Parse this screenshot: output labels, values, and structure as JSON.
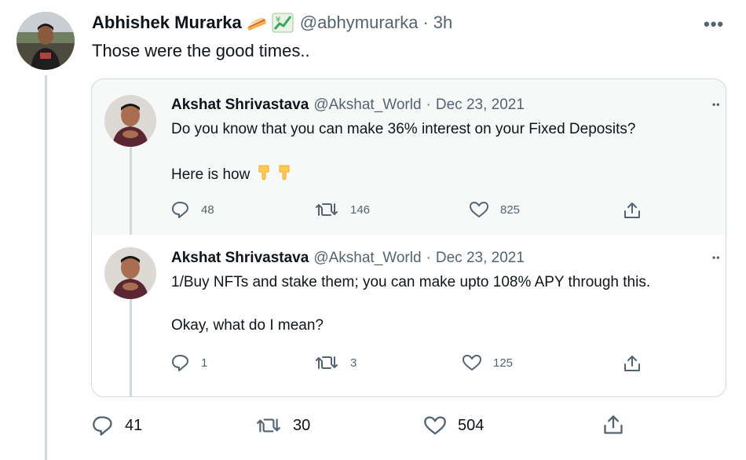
{
  "main_tweet": {
    "author_name": "Abhishek Murarka",
    "handle": "@abhymurarka",
    "separator": "·",
    "time": "3h",
    "text": "Those were the good times..",
    "name_emojis": [
      "pie-emoji",
      "chart-yen-emoji"
    ],
    "actions": {
      "replies": "41",
      "retweets": "30",
      "likes": "504"
    }
  },
  "quoted_thread": [
    {
      "author_name": "Akshat Shrivastava",
      "handle": "@Akshat_World",
      "separator": "·",
      "date": "Dec 23, 2021",
      "text_line1": "Do you know that you can make 36% interest on your Fixed Deposits?",
      "text_line2": "Here is how",
      "text_line2_emojis": [
        "point-down-emoji",
        "point-down-emoji"
      ],
      "actions": {
        "replies": "48",
        "retweets": "146",
        "likes": "825"
      }
    },
    {
      "author_name": "Akshat Shrivastava",
      "handle": "@Akshat_World",
      "separator": "·",
      "date": "Dec 23, 2021",
      "text_line1": "1/Buy NFTs and stake them; you can make upto 108% APY through this.",
      "text_line2": "Okay, what do I mean?",
      "actions": {
        "replies": "1",
        "retweets": "3",
        "likes": "125"
      }
    }
  ],
  "colors": {
    "text": "#0f1419",
    "secondary": "#536471",
    "border": "#cfd9de",
    "hover_bg": "#f7f9f9"
  }
}
